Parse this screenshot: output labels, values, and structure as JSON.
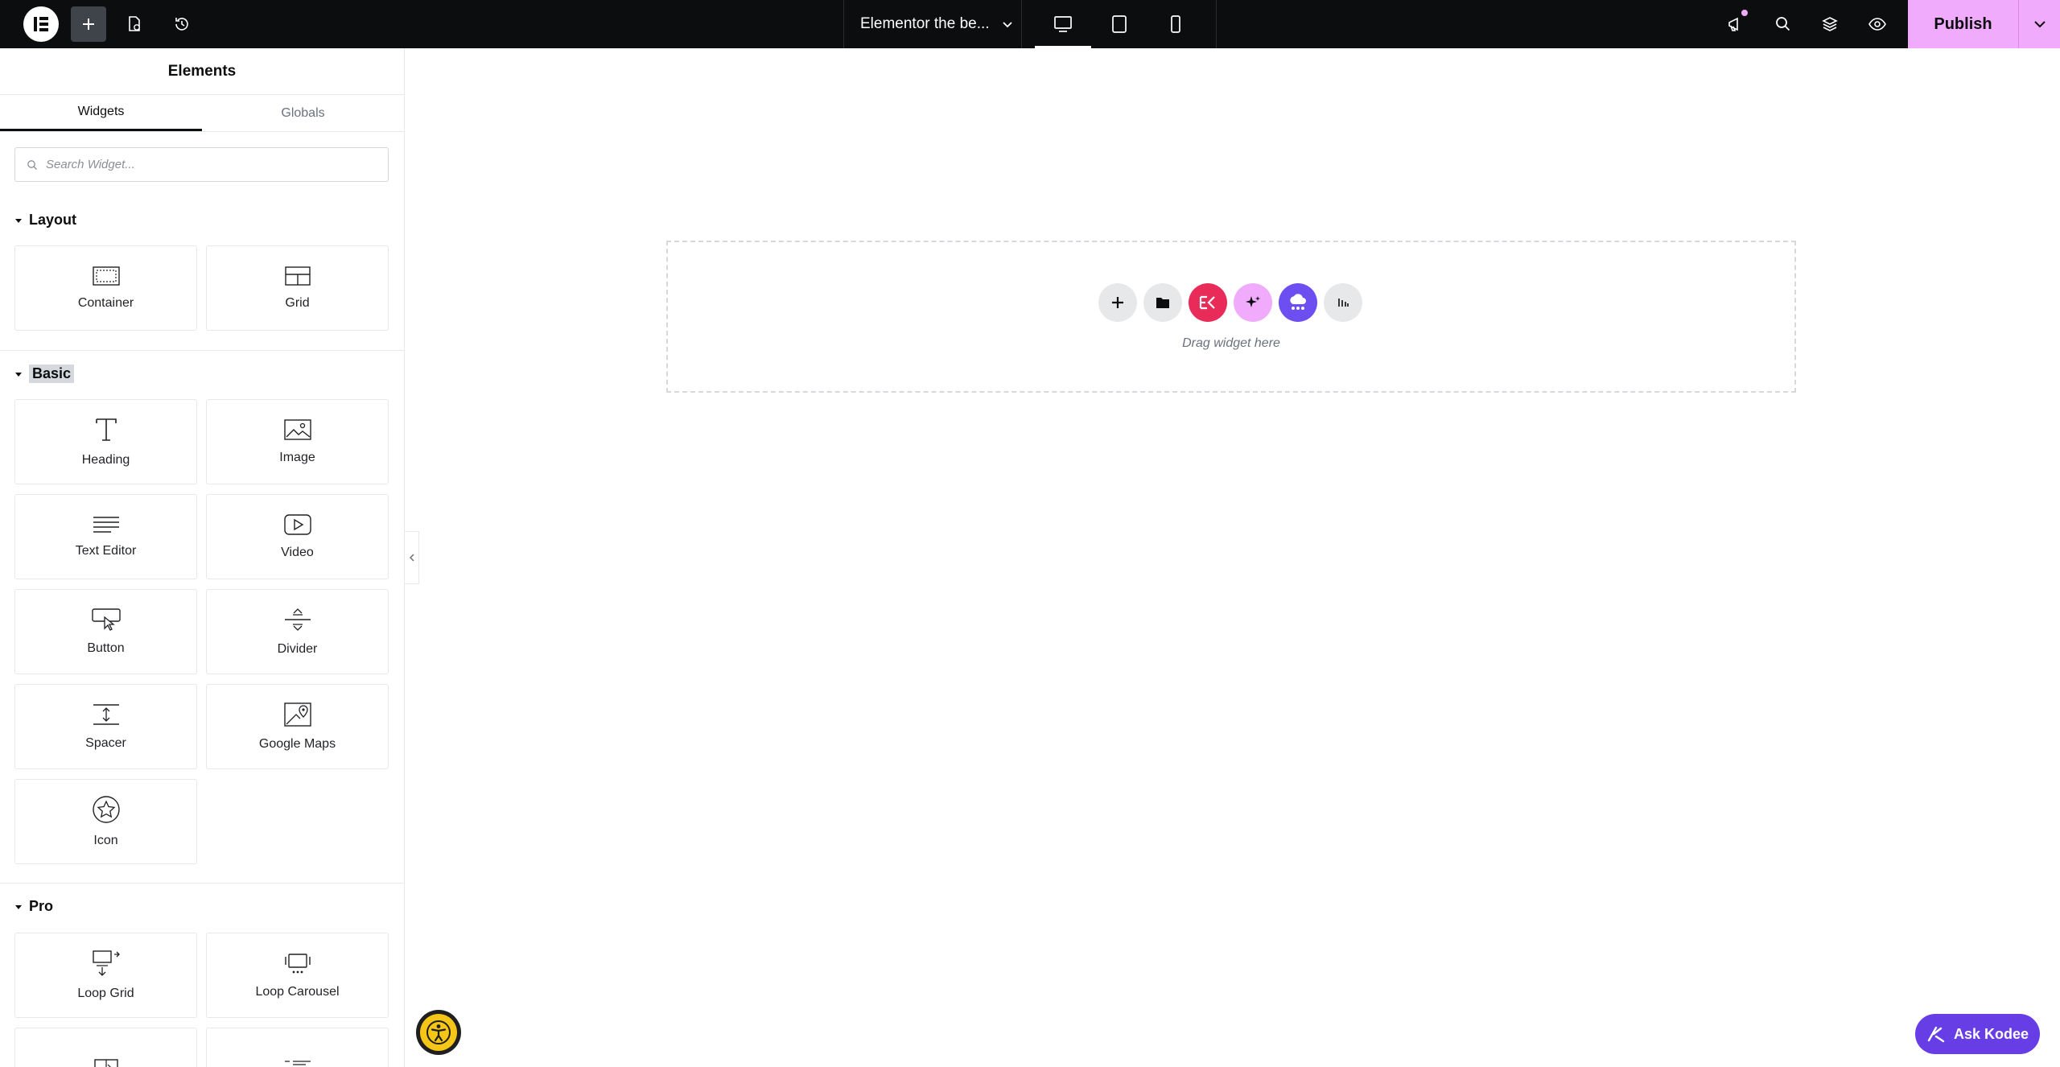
{
  "topbar": {
    "document_title": "Elementor the be...",
    "publish_label": "Publish"
  },
  "panel": {
    "title": "Elements",
    "tabs": [
      {
        "label": "Widgets",
        "active": true
      },
      {
        "label": "Globals",
        "active": false
      }
    ],
    "search_placeholder": "Search Widget...",
    "categories": {
      "layout": {
        "label": "Layout",
        "widgets": [
          "Container",
          "Grid"
        ]
      },
      "basic": {
        "label": "Basic",
        "widgets": [
          "Heading",
          "Image",
          "Text Editor",
          "Video",
          "Button",
          "Divider",
          "Spacer",
          "Google Maps",
          "Icon"
        ]
      },
      "pro": {
        "label": "Pro",
        "widgets": [
          "Loop Grid",
          "Loop Carousel"
        ]
      }
    }
  },
  "canvas": {
    "drop_text": "Drag widget here"
  },
  "assistant": {
    "label": "Ask Kodee"
  },
  "colors": {
    "topbar_bg": "#0c0d0e",
    "publish_bg": "#f0abfc",
    "kodee_bg": "#673de6",
    "elementor_red": "#e92b5a",
    "ai_pink": "#f0abfc",
    "cloud_purple": "#6d4ef0"
  }
}
